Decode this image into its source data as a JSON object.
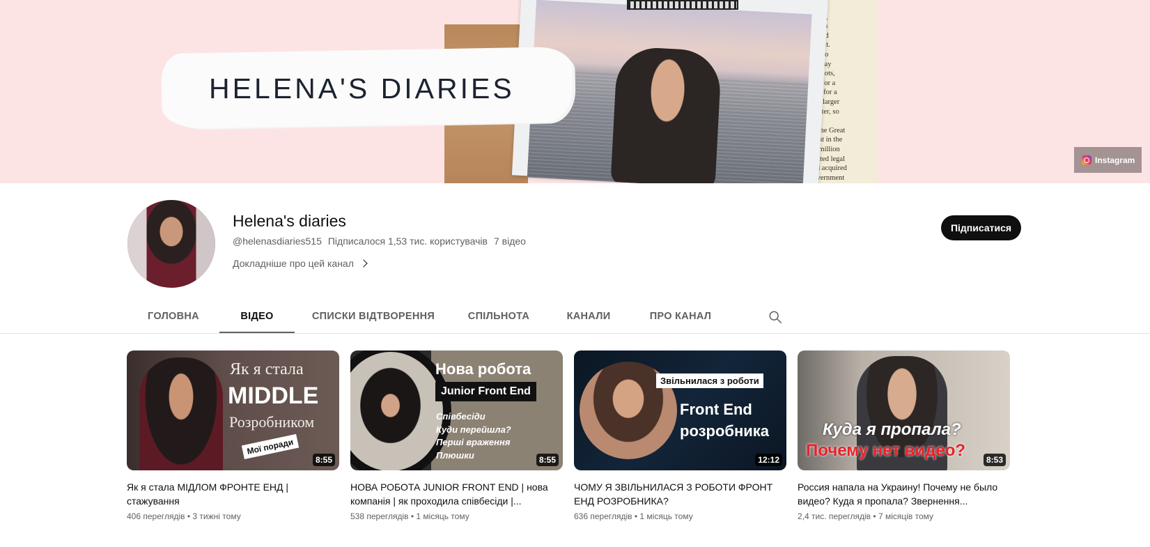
{
  "banner": {
    "title": "HELENA'S DIARIES",
    "book_lines": [
      "house",
      "strong",
      "blown",
      "ch and",
      "with it.",
      "s, who",
      "holiday",
      "eir plots,",
      "hey for a",
      "sold for a",
      "was larger",
      "aracter, so",
      "",
      "ad the Great",
      "ment in the",
      "r a million",
      "licated legal",
      "had acquired",
      "government"
    ],
    "instagram_label": "Instagram"
  },
  "channel": {
    "name": "Helena's diaries",
    "handle": "@helenasdiaries515",
    "subscribers": "Підписалося 1,53 тис. користувачів",
    "video_count": "7 відео",
    "more_about": "Докладніше про цей канал",
    "subscribe_label": "Підписатися"
  },
  "tabs": [
    {
      "label": "ГОЛОВНА",
      "active": false
    },
    {
      "label": "ВІДЕО",
      "active": true
    },
    {
      "label": "СПИСКИ ВІДТВОРЕННЯ",
      "active": false
    },
    {
      "label": "СПІЛЬНОТА",
      "active": false
    },
    {
      "label": "КАНАЛИ",
      "active": false
    },
    {
      "label": "ПРО КАНАЛ",
      "active": false
    }
  ],
  "videos": [
    {
      "title": "Як я стала МІДЛОМ ФРОНТЕ ЕНД | стажування",
      "views": "406 переглядів",
      "age": "3 тижні тому",
      "duration": "8:55",
      "thumb_text": [
        "Як я стала",
        "MIDDLE",
        "Розробником",
        "Мої поради"
      ]
    },
    {
      "title": "НОВА РОБОТА JUNIOR FRONT END | нова компанія | як проходила співбесіди |...",
      "views": "538 переглядів",
      "age": "1 місяць тому",
      "duration": "8:55",
      "thumb_text": [
        "Нова робота",
        "Junior Front End",
        "Співбесіди",
        "Куди перейшла?",
        "Перші враження",
        "Плюшки"
      ]
    },
    {
      "title": "ЧОМУ Я ЗВІЛЬНИЛАСЯ З РОБОТИ ФРОНТ ЕНД РОЗРОБНИКА?",
      "views": "636 переглядів",
      "age": "1 місяць тому",
      "duration": "12:12",
      "thumb_text": [
        "Звільнилася з роботи",
        "Front End",
        "розробника"
      ]
    },
    {
      "title": "Россия напала на Украину! Почему не было видео? Куда я пропала? Звернення...",
      "views": "2,4 тис. переглядів",
      "age": "7 місяців тому",
      "duration": "8:53",
      "thumb_text": [
        "Куда я пропала?",
        "Почему нет видео?"
      ]
    }
  ],
  "meta_separator": "•"
}
